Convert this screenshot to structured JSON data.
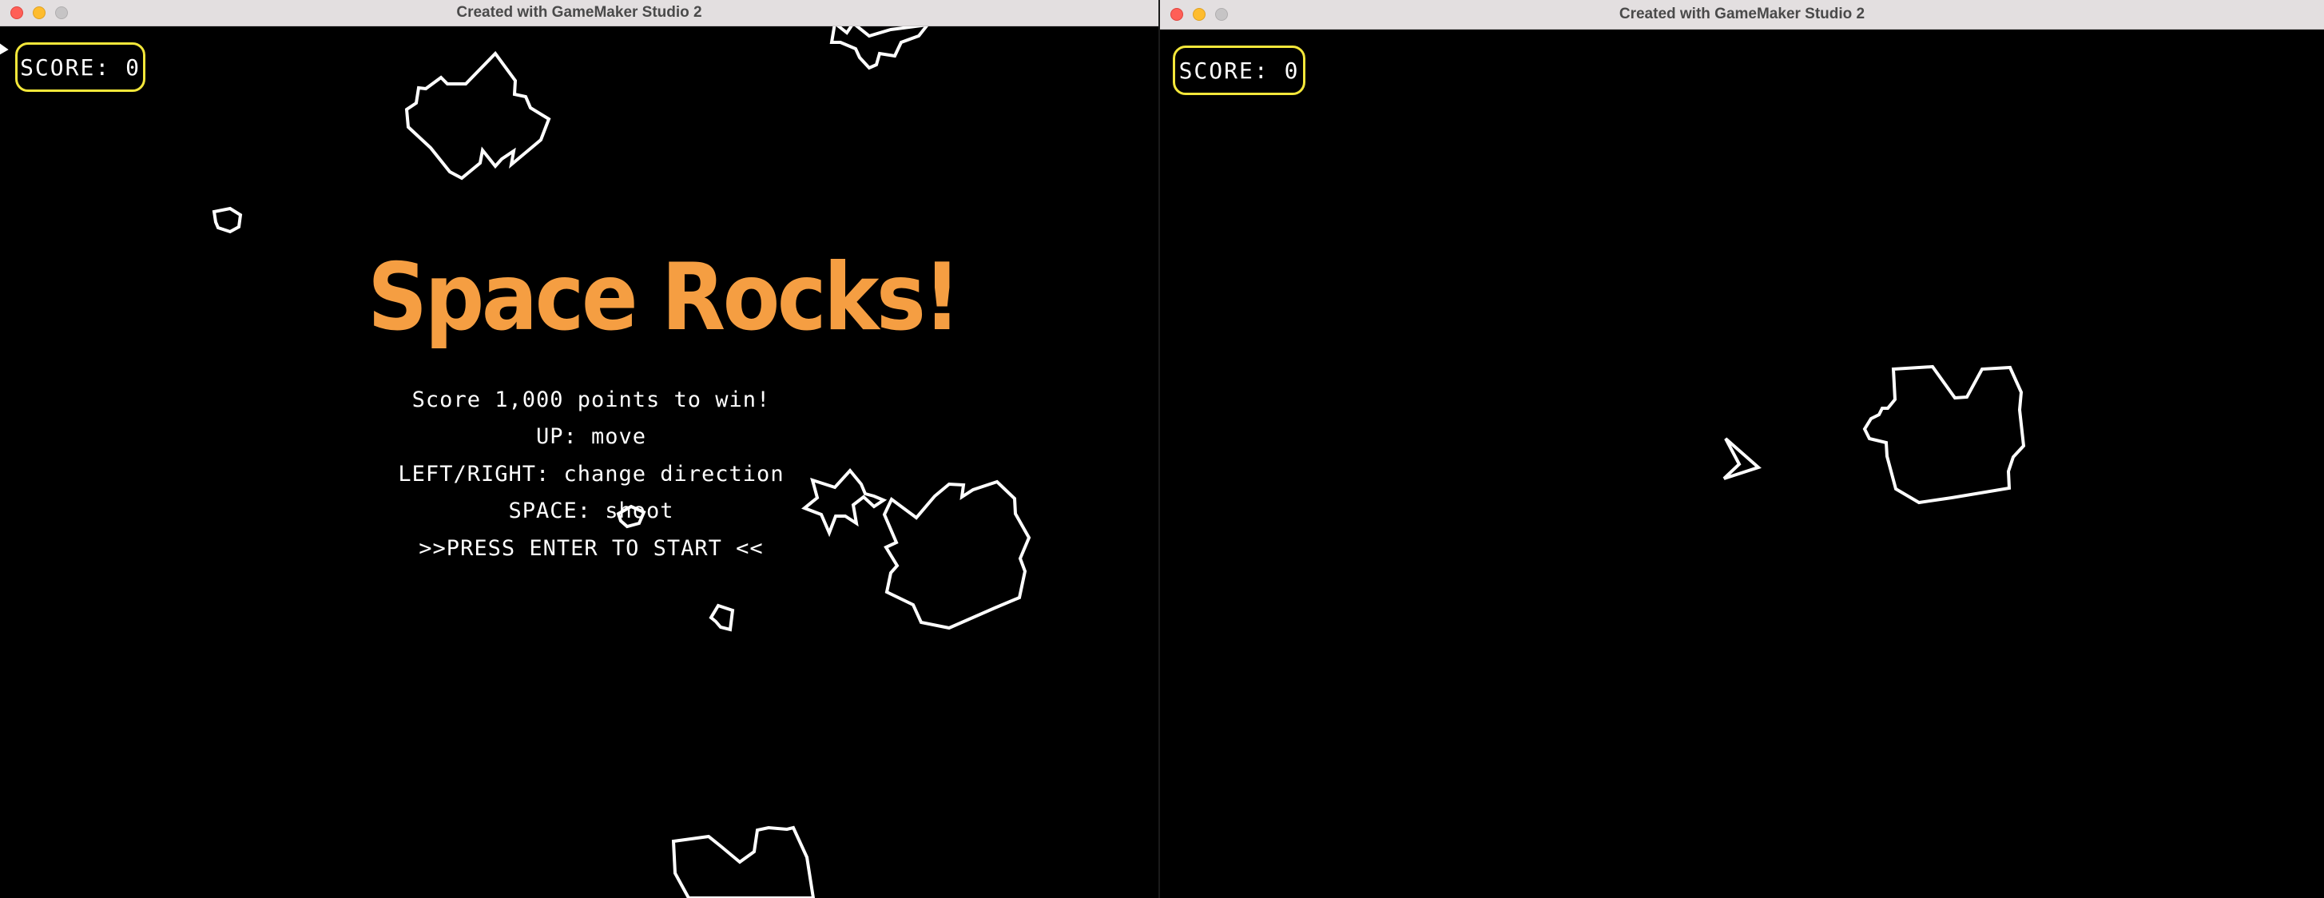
{
  "windows": {
    "left": {
      "title": "Created with GameMaker Studio 2",
      "score": "SCORE: 0"
    },
    "right": {
      "title": "Created with GameMaker Studio 2",
      "score": "SCORE: 0"
    }
  },
  "title_screen": {
    "game_title": "Space Rocks!",
    "instructions": [
      "Score 1,000 points to win!",
      "UP: move",
      "LEFT/RIGHT: change direction",
      "SPACE: shoot",
      ">>PRESS ENTER TO START <<"
    ]
  },
  "colors": {
    "background": "#000000",
    "title": "#f59e42",
    "score_border": "#f3e73a",
    "outline": "#ffffff"
  }
}
